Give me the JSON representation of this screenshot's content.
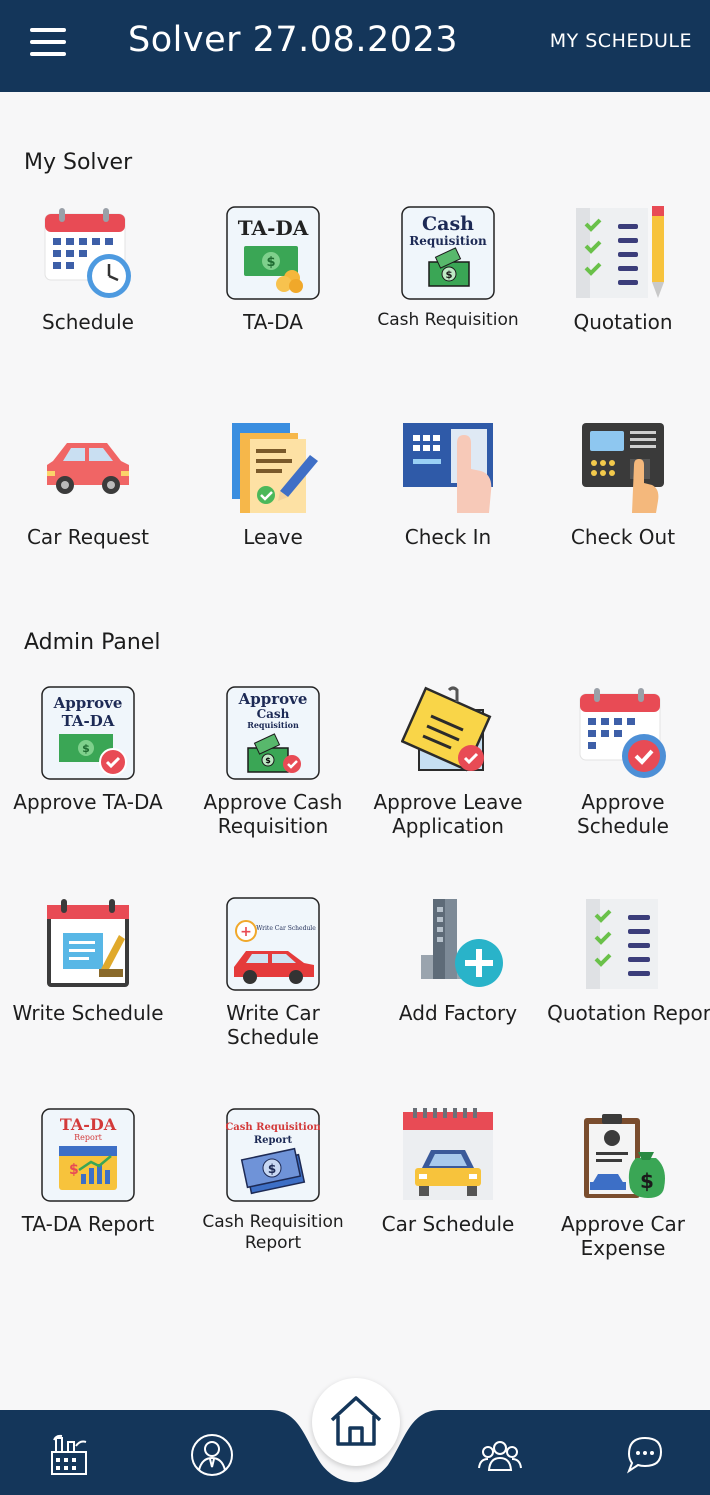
{
  "appbar": {
    "title": "Solver 27.08.2023",
    "schedule_link": "MY SCHEDULE"
  },
  "sections": {
    "my_solver": "My Solver",
    "admin_panel": "Admin Panel"
  },
  "my_solver": [
    {
      "label": "Schedule",
      "icon": "calendar-clock-icon"
    },
    {
      "label": "TA-DA",
      "icon": "ta-da-money-icon",
      "icon_text": "TA-DA"
    },
    {
      "label": "Cash Requisition",
      "icon": "cash-requisition-icon",
      "icon_text": [
        "Cash",
        "Requisition"
      ]
    },
    {
      "label": "Quotation",
      "icon": "checklist-pencil-icon"
    },
    {
      "label": "Car Request",
      "icon": "car-icon"
    },
    {
      "label": "Leave",
      "icon": "document-pen-icon"
    },
    {
      "label": "Check In",
      "icon": "keypad-finger-icon"
    },
    {
      "label": "Check Out",
      "icon": "fingerprint-device-icon"
    }
  ],
  "admin_panel": [
    {
      "label": "Approve TA-DA",
      "icon": "approve-ta-da-icon",
      "icon_text": [
        "Approve",
        "TA-DA"
      ]
    },
    {
      "label": "Approve Cash Requisition",
      "icon": "approve-cash-icon",
      "icon_text": [
        "Approve",
        "Cash",
        "Requisition"
      ]
    },
    {
      "label": "Approve Leave Application",
      "icon": "approve-leave-icon"
    },
    {
      "label": "Approve Schedule",
      "icon": "approve-calendar-icon"
    },
    {
      "label": "Write Schedule",
      "icon": "write-calendar-icon"
    },
    {
      "label": "Write Car Schedule",
      "icon": "write-car-schedule-icon",
      "icon_text": "Write Car Schedule"
    },
    {
      "label": "Add Factory",
      "icon": "add-factory-icon"
    },
    {
      "label": "Quotation Report",
      "icon": "checklist-report-icon"
    },
    {
      "label": "TA-DA Report",
      "icon": "ta-da-report-icon",
      "icon_text": [
        "TA-DA",
        "Report"
      ]
    },
    {
      "label": "Cash Requisition Report",
      "icon": "cash-report-icon",
      "icon_text": [
        "Cash Requisition",
        "Report"
      ]
    },
    {
      "label": "Car Schedule",
      "icon": "car-calendar-icon"
    },
    {
      "label": "Approve Car Expense",
      "icon": "car-expense-icon"
    }
  ],
  "colors": {
    "appbar": "#14365a",
    "background": "#f7f7f8",
    "accent_red": "#e84b55",
    "money_green": "#3aa655"
  },
  "bottom_nav": [
    {
      "icon": "factory-icon"
    },
    {
      "icon": "user-tie-icon"
    },
    {
      "icon": "home-icon"
    },
    {
      "icon": "group-icon"
    },
    {
      "icon": "chat-icon"
    }
  ]
}
